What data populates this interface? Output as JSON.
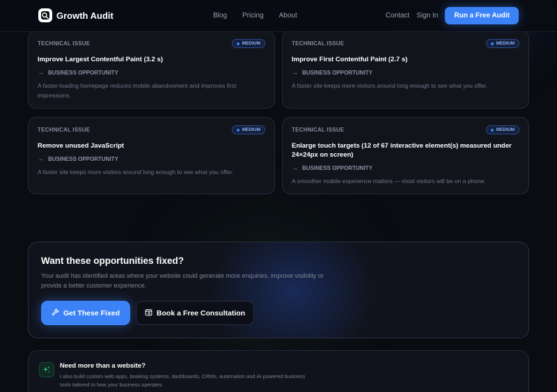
{
  "nav": {
    "brand": "Growth Audit",
    "links": [
      "Blog",
      "Pricing",
      "About"
    ],
    "contact": "Contact",
    "sign_in": "Sign In",
    "cta": "Run a Free Audit"
  },
  "cards": [
    {
      "kicker": "TECHNICAL ISSUE",
      "badge": "MEDIUM",
      "title": "Improve Largest Contentful Paint (3.2 s)",
      "opportunity_label": "BUSINESS OPPORTUNITY",
      "description": "A faster-loading homepage reduces mobile abandonment and improves first impressions."
    },
    {
      "kicker": "TECHNICAL ISSUE",
      "badge": "MEDIUM",
      "title": "Improve First Contentful Paint (2.7 s)",
      "opportunity_label": "BUSINESS OPPORTUNITY",
      "description": "A faster site keeps more visitors around long enough to see what you offer."
    },
    {
      "kicker": "TECHNICAL ISSUE",
      "badge": "MEDIUM",
      "title": "Remove unused JavaScript",
      "opportunity_label": "BUSINESS OPPORTUNITY",
      "description": "A faster site keeps more visitors around long enough to see what you offer."
    },
    {
      "kicker": "TECHNICAL ISSUE",
      "badge": "MEDIUM",
      "title": "Enlarge touch targets (12 of 67 interactive element(s) measured under 24×24px on screen)",
      "opportunity_label": "BUSINESS OPPORTUNITY",
      "description": "A smoother mobile experience matters — most visitors will be on a phone."
    }
  ],
  "cta": {
    "heading": "Want these opportunities fixed?",
    "body": "Your audit has identified areas where your website could generate more enquiries, improve visibility or provide a better customer experience.",
    "primary_button": "Get These Fixed",
    "secondary_button": "Book a Free Consultation"
  },
  "more": {
    "heading": "Need more than a website?",
    "body": "I also build custom web apps, booking systems, dashboards, CRMs, automation and AI-powered business tools tailored to how your business operates."
  },
  "icons": {
    "brand": "audit-logo-icon",
    "arrow": "arrow-right-icon",
    "fix": "wrench-icon",
    "book": "calendar-icon",
    "more": "sparkles-icon"
  },
  "colors": {
    "background": "#0a0c12",
    "accent": "#3b82f6",
    "card": "#12141c",
    "badge_text": "#8fb2f5",
    "more_icon": "#34d399"
  }
}
